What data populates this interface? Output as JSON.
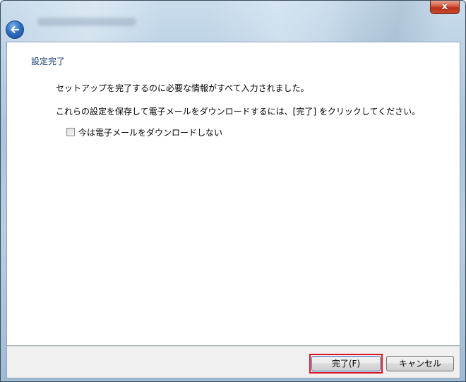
{
  "window": {
    "close_label": "x"
  },
  "page": {
    "heading": "設定完了",
    "line1": "セットアップを完了するのに必要な情報がすべて入力されました。",
    "line2": "これらの設定を保存して電子メールをダウンロードするには、[完了] をクリックしてください。",
    "checkbox_label": "今は電子メールをダウンロードしない",
    "checkbox_checked": false
  },
  "footer": {
    "finish_label": "完了(F)",
    "cancel_label": "キャンセル"
  },
  "colors": {
    "heading": "#1d3e7a",
    "highlight": "#e0141e"
  }
}
